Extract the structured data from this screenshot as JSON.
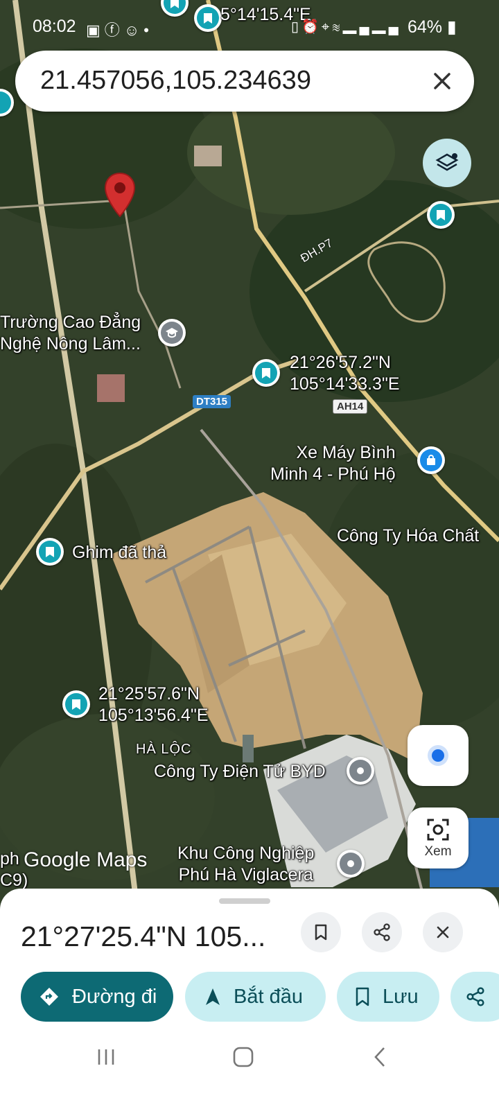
{
  "status_bar": {
    "time": "08:02",
    "battery": "64%",
    "left_icons": [
      "gallery-icon",
      "facebook-icon",
      "user-icon",
      "dot-icon"
    ],
    "right_icons": [
      "nfc-icon",
      "alarm-icon",
      "location-icon",
      "wifi-icon",
      "signal-icon",
      "signal-icon"
    ]
  },
  "search": {
    "query": "21.457056,105.234639"
  },
  "map": {
    "top_partial_coord": "5°14'15.4\"E",
    "labels": {
      "college": "Trường Cao Đẳng\nNghệ Nông Lâm...",
      "coord_pin_1": "21°26'57.2\"N\n105°14'33.3\"E",
      "motorbike_shop": "Xe Máy Bình\nMinh 4 - Phú Hộ",
      "chemical_company": "Công Ty Hóa Chất",
      "dropped_pin": "Ghim đã thả",
      "coord_pin_2": "21°25'57.6\"N\n105°13'56.4\"E",
      "ha_loc": "HÀ LỘC",
      "byd": "Công Ty Điện Tử BYD",
      "industrial_park": "Khu Công Nghiệp\nPhú Hà Viglacera",
      "left_partial": "ph\nC9)"
    },
    "roads": {
      "dt315": "DT315",
      "ah14": "AH14",
      "dh_p7": "ĐH.P7"
    },
    "watermark": "Google Maps",
    "colors": {
      "pin_teal": "#13a3b4",
      "dropped_pin_red": "#d32f2f",
      "place_grey": "#7d858c",
      "shop_blue": "#1a8be8"
    }
  },
  "controls": {
    "layers_icon": "layers-icon",
    "my_location_icon": "my-location-icon",
    "lens_label": "Xem"
  },
  "sheet": {
    "title": "21°27'25.4\"N 105...",
    "actions": {
      "directions": "Đường đi",
      "start": "Bắt đầu",
      "save": "Lưu"
    },
    "accent": "#0d6a74"
  }
}
